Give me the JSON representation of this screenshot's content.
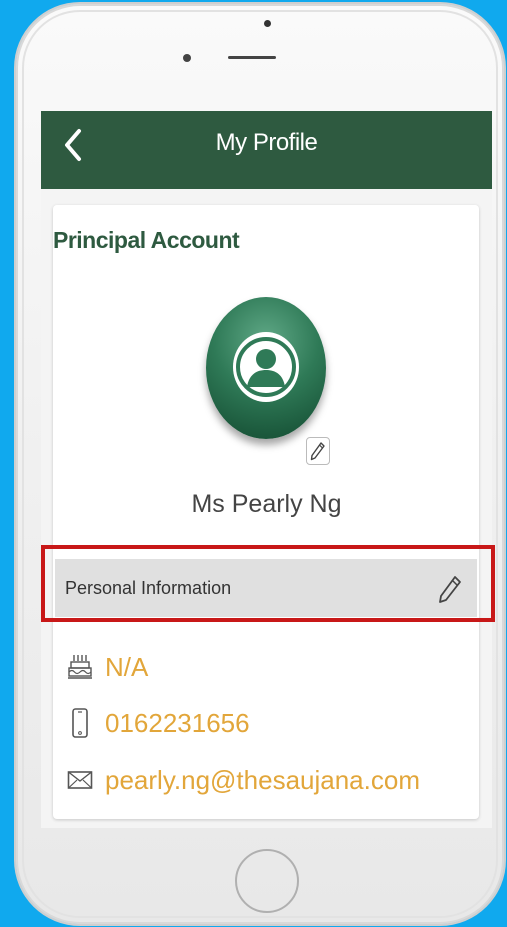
{
  "colors": {
    "background": "#10a9ee",
    "navbar": "#2e5a40",
    "accent_text": "#e2a63a",
    "highlight_border": "#c81818",
    "section_bar": "#e0e0e0"
  },
  "header": {
    "title": "My Profile",
    "back_icon": "chevron-left-icon"
  },
  "profile": {
    "account_type": "Principal Account",
    "avatar_icon": "user-avatar-icon",
    "avatar_edit_icon": "pencil-icon",
    "name": "Ms Pearly Ng"
  },
  "personal_info": {
    "section_label": "Personal Information",
    "edit_icon": "pencil-icon",
    "items": [
      {
        "icon": "birthday-cake-icon",
        "value": "N/A"
      },
      {
        "icon": "mobile-phone-icon",
        "value": "0162231656"
      },
      {
        "icon": "envelope-icon",
        "value": "pearly.ng@thesaujana.com"
      }
    ]
  }
}
